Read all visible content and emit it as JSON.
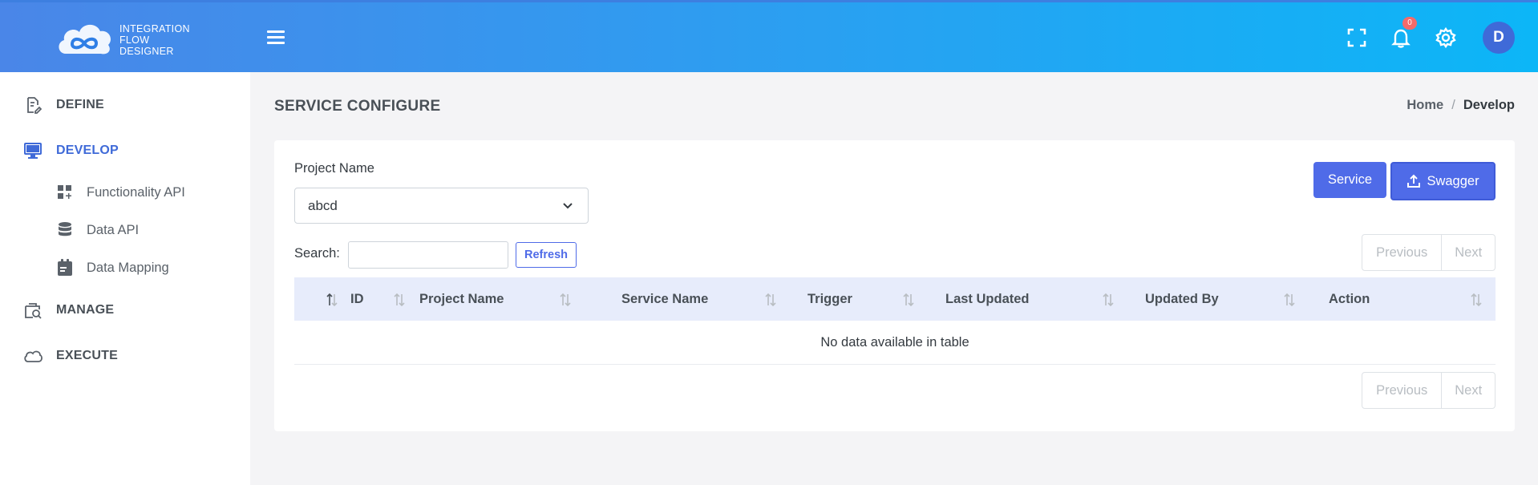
{
  "header": {
    "brand_lines": [
      "INTEGRATION",
      "FLOW",
      "DESIGNER"
    ],
    "notification_count": "0",
    "avatar_initial": "D"
  },
  "sidebar": {
    "items": [
      {
        "label": "DEFINE",
        "icon": "edit-document-icon"
      },
      {
        "label": "DEVELOP",
        "icon": "monitor-icon",
        "active": true
      },
      {
        "label": "MANAGE",
        "icon": "search-document-icon"
      },
      {
        "label": "EXECUTE",
        "icon": "cloud-icon"
      }
    ],
    "develop_subitems": [
      {
        "label": "Functionality API",
        "icon": "grid-plus-icon"
      },
      {
        "label": "Data API",
        "icon": "database-icon"
      },
      {
        "label": "Data Mapping",
        "icon": "clipboard-icon"
      }
    ]
  },
  "page": {
    "title": "SERVICE CONFIGURE",
    "breadcrumb": {
      "home": "Home",
      "separator": "/",
      "current": "Develop"
    }
  },
  "form": {
    "project_label": "Project Name",
    "project_value": "abcd",
    "service_button": "Service",
    "swagger_button": "Swagger",
    "search_label": "Search:",
    "search_value": "",
    "refresh_button": "Refresh"
  },
  "table": {
    "columns": [
      "ID",
      "Project Name",
      "Service Name",
      "Trigger",
      "Last Updated",
      "Updated By",
      "Action"
    ],
    "empty_message": "No data available in table"
  },
  "pagination": {
    "previous": "Previous",
    "next": "Next"
  },
  "colors": {
    "accent": "#4f6be8",
    "header_start": "#4a86e8",
    "header_end": "#0cb6f7",
    "table_header": "#e7ecfb",
    "badge": "#f46a6a"
  }
}
